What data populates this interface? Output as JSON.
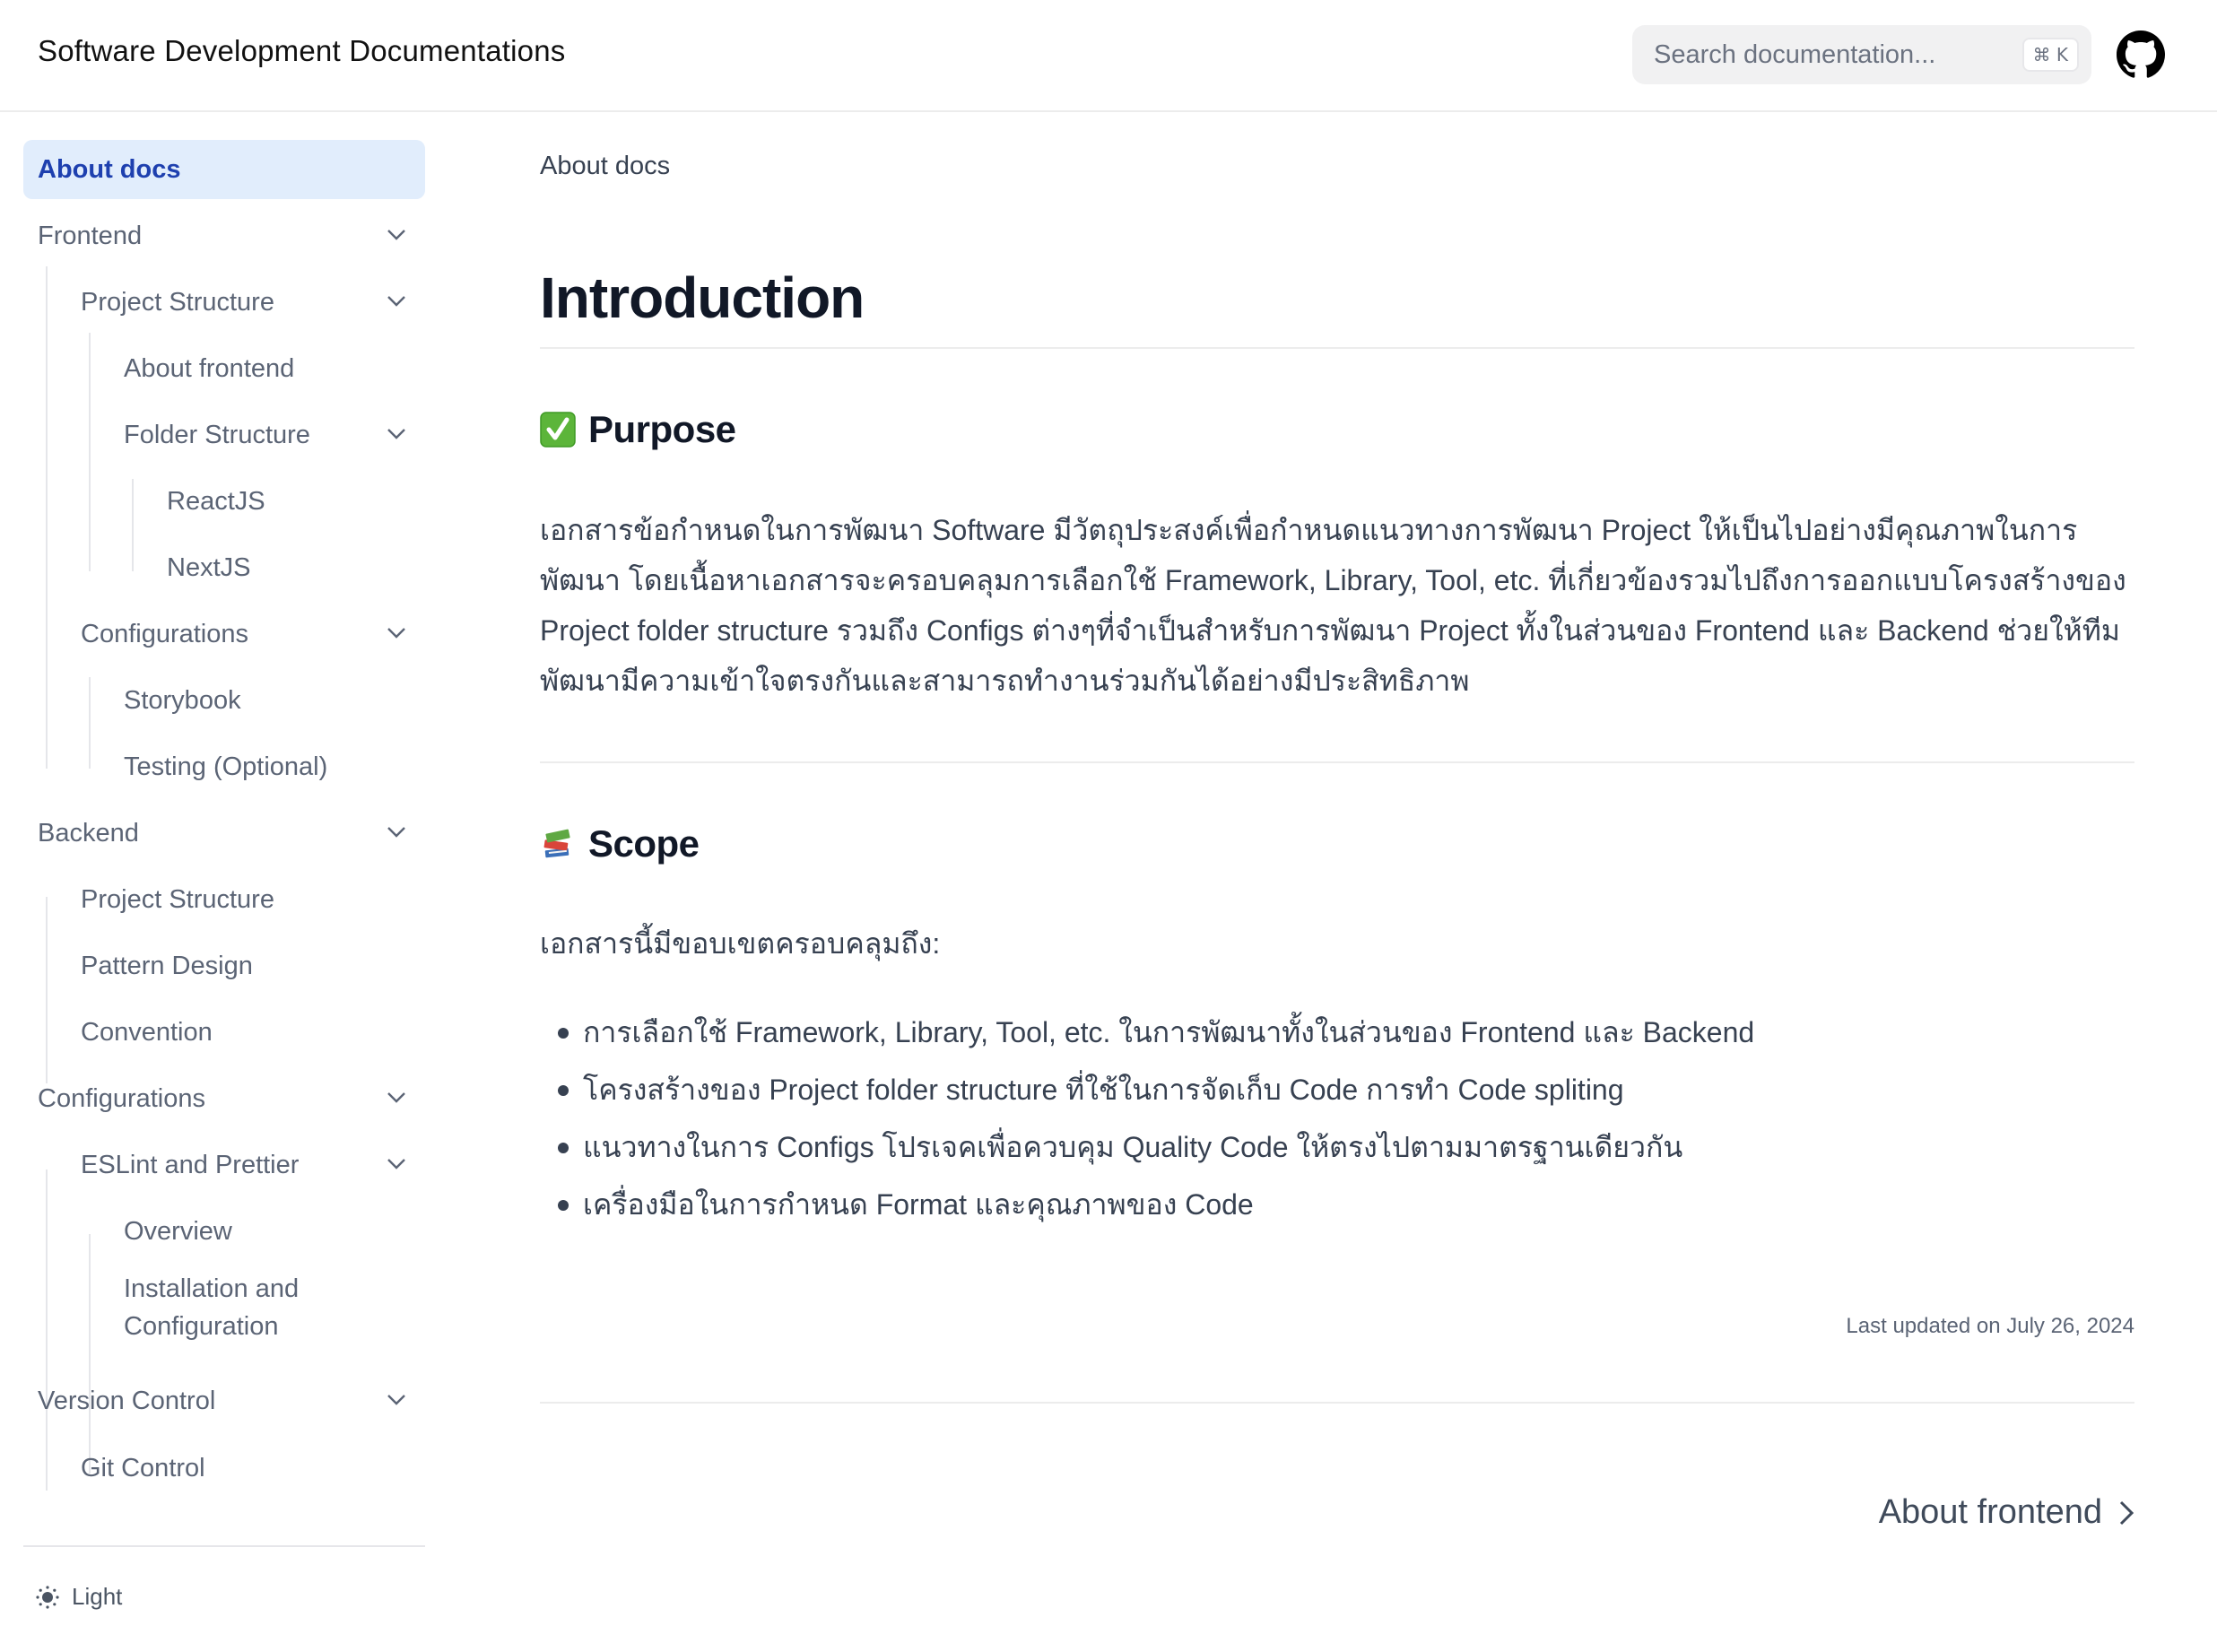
{
  "header": {
    "title": "Software Development Documentations",
    "search": {
      "placeholder": "Search documentation...",
      "value": "",
      "shortcut": "⌘ K",
      "icon": "search-input"
    },
    "github_icon": "github-icon"
  },
  "sidebar": {
    "items": [
      {
        "label": "About docs",
        "level": 0,
        "active": true,
        "expandable": false
      },
      {
        "label": "Frontend",
        "level": 0,
        "expandable": true
      },
      {
        "label": "Project Structure",
        "level": 1,
        "expandable": true
      },
      {
        "label": "About frontend",
        "level": 2,
        "expandable": false
      },
      {
        "label": "Folder Structure",
        "level": 2,
        "expandable": true
      },
      {
        "label": "ReactJS",
        "level": 3,
        "expandable": false
      },
      {
        "label": "NextJS",
        "level": 3,
        "expandable": false
      },
      {
        "label": "Configurations",
        "level": 1,
        "expandable": true
      },
      {
        "label": "Storybook",
        "level": 2,
        "expandable": false
      },
      {
        "label": "Testing (Optional)",
        "level": 2,
        "expandable": false
      },
      {
        "label": "Backend",
        "level": 0,
        "expandable": true
      },
      {
        "label": "Project Structure",
        "level": 1,
        "expandable": false
      },
      {
        "label": "Pattern Design",
        "level": 1,
        "expandable": false
      },
      {
        "label": "Convention",
        "level": 1,
        "expandable": false
      },
      {
        "label": "Configurations",
        "level": 0,
        "expandable": true
      },
      {
        "label": "ESLint and Prettier",
        "level": 1,
        "expandable": true
      },
      {
        "label": "Overview",
        "level": 2,
        "expandable": false
      },
      {
        "label": "Installation and Configuration",
        "level": 2,
        "expandable": false
      },
      {
        "label": "Version Control",
        "level": 0,
        "expandable": true
      },
      {
        "label": "Git Control",
        "level": 1,
        "expandable": false
      }
    ],
    "theme_toggle": {
      "label": "Light",
      "icon": "sun-icon"
    }
  },
  "main": {
    "breadcrumb": "About docs",
    "title": "Introduction",
    "purpose": {
      "emoji": "✅",
      "heading": "Purpose",
      "paragraph": "เอกสารข้อกำหนดในการพัฒนา Software มีวัตถุประสงค์เพื่อกำหนดแนวทางการพัฒนา Project ให้เป็นไปอย่างมีคุณภาพในการพัฒนา โดยเนื้อหาเอกสารจะครอบคลุมการเลือกใช้ Framework, Library, Tool, etc. ที่เกี่ยวข้องรวมไปถึงการออกแบบโครงสร้างของ Project folder structure รวมถึง Configs ต่างๆที่จำเป็นสำหรับการพัฒนา Project ทั้งในส่วนของ Frontend และ Backend ช่วยให้ทีมพัฒนามีความเข้าใจตรงกันและสามารถทำงานร่วมกันได้อย่างมีประสิทธิภาพ"
    },
    "scope": {
      "emoji": "📚",
      "heading": "Scope",
      "intro": "เอกสารนี้มีขอบเขตครอบคลุมถึง:",
      "items": [
        "การเลือกใช้ Framework, Library, Tool, etc. ในการพัฒนาทั้งในส่วนของ Frontend และ Backend",
        "โครงสร้างของ Project folder structure ที่ใช้ในการจัดเก็บ Code การทำ Code spliting",
        "แนวทางในการ Configs โปรเจคเพื่อควบคุม Quality Code ให้ตรงไปตามมาตรฐานเดียวกัน",
        "เครื่องมือในการกำหนด Format และคุณภาพของ Code"
      ]
    },
    "last_updated": "Last updated on July 26, 2024",
    "next_link": {
      "label": "About frontend",
      "icon": "chevron-right-icon"
    }
  },
  "colors": {
    "active_bg": "#e1edfc",
    "active_text": "#1e40af",
    "heading": "#111827",
    "body": "#374151",
    "nav_text": "#5b6475"
  }
}
